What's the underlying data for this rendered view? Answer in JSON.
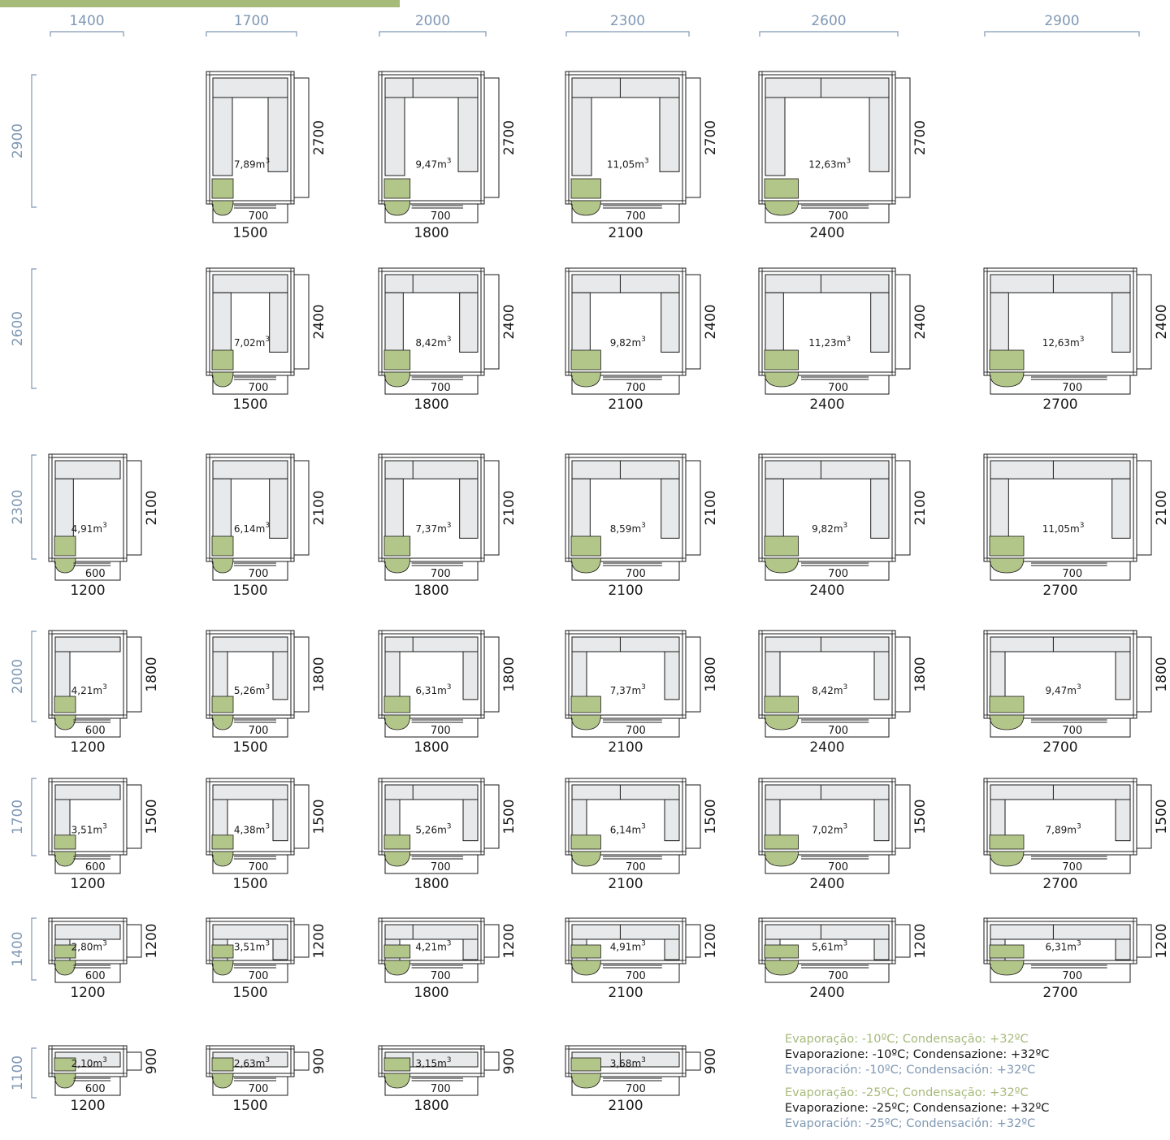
{
  "colors": {
    "line": "#1a1a1a",
    "shelf_fill": "#e8e9eb",
    "evaporator_fill": "#b3c689",
    "accent_green": "#a6ba7a",
    "axis_blue": "#7f98b4",
    "text": "#1a1a1a"
  },
  "columns": [
    {
      "label": "1400"
    },
    {
      "label": "1700"
    },
    {
      "label": "2000"
    },
    {
      "label": "2300"
    },
    {
      "label": "2600"
    },
    {
      "label": "2900"
    }
  ],
  "rows": [
    {
      "label": "2900",
      "inner_depth": "2700"
    },
    {
      "label": "2600",
      "inner_depth": "2400"
    },
    {
      "label": "2300",
      "inner_depth": "2100"
    },
    {
      "label": "2000",
      "inner_depth": "1800"
    },
    {
      "label": "1700",
      "inner_depth": "1500"
    },
    {
      "label": "1400",
      "inner_depth": "1200"
    },
    {
      "label": "1100",
      "inner_depth": "900"
    }
  ],
  "inner_widths": [
    "1200",
    "1500",
    "1800",
    "2100",
    "2400",
    "2700"
  ],
  "cells": [
    {
      "row": 0,
      "col": 1,
      "volume": "7,89",
      "door": "700"
    },
    {
      "row": 0,
      "col": 2,
      "volume": "9,47",
      "door": "700"
    },
    {
      "row": 0,
      "col": 3,
      "volume": "11,05",
      "door": "700"
    },
    {
      "row": 0,
      "col": 4,
      "volume": "12,63",
      "door": "700"
    },
    {
      "row": 1,
      "col": 1,
      "volume": "7,02",
      "door": "700"
    },
    {
      "row": 1,
      "col": 2,
      "volume": "8,42",
      "door": "700"
    },
    {
      "row": 1,
      "col": 3,
      "volume": "9,82",
      "door": "700"
    },
    {
      "row": 1,
      "col": 4,
      "volume": "11,23",
      "door": "700"
    },
    {
      "row": 1,
      "col": 5,
      "volume": "12,63",
      "door": "700"
    },
    {
      "row": 2,
      "col": 0,
      "volume": "4,91",
      "door": "600"
    },
    {
      "row": 2,
      "col": 1,
      "volume": "6,14",
      "door": "700"
    },
    {
      "row": 2,
      "col": 2,
      "volume": "7,37",
      "door": "700"
    },
    {
      "row": 2,
      "col": 3,
      "volume": "8,59",
      "door": "700"
    },
    {
      "row": 2,
      "col": 4,
      "volume": "9,82",
      "door": "700"
    },
    {
      "row": 2,
      "col": 5,
      "volume": "11,05",
      "door": "700"
    },
    {
      "row": 3,
      "col": 0,
      "volume": "4,21",
      "door": "600"
    },
    {
      "row": 3,
      "col": 1,
      "volume": "5,26",
      "door": "700"
    },
    {
      "row": 3,
      "col": 2,
      "volume": "6,31",
      "door": "700"
    },
    {
      "row": 3,
      "col": 3,
      "volume": "7,37",
      "door": "700"
    },
    {
      "row": 3,
      "col": 4,
      "volume": "8,42",
      "door": "700"
    },
    {
      "row": 3,
      "col": 5,
      "volume": "9,47",
      "door": "700"
    },
    {
      "row": 4,
      "col": 0,
      "volume": "3,51",
      "door": "600"
    },
    {
      "row": 4,
      "col": 1,
      "volume": "4,38",
      "door": "700"
    },
    {
      "row": 4,
      "col": 2,
      "volume": "5,26",
      "door": "700"
    },
    {
      "row": 4,
      "col": 3,
      "volume": "6,14",
      "door": "700"
    },
    {
      "row": 4,
      "col": 4,
      "volume": "7,02",
      "door": "700"
    },
    {
      "row": 4,
      "col": 5,
      "volume": "7,89",
      "door": "700"
    },
    {
      "row": 5,
      "col": 0,
      "volume": "2,80",
      "door": "600"
    },
    {
      "row": 5,
      "col": 1,
      "volume": "3,51",
      "door": "700"
    },
    {
      "row": 5,
      "col": 2,
      "volume": "4,21",
      "door": "700"
    },
    {
      "row": 5,
      "col": 3,
      "volume": "4,91",
      "door": "700"
    },
    {
      "row": 5,
      "col": 4,
      "volume": "5,61",
      "door": "700"
    },
    {
      "row": 5,
      "col": 5,
      "volume": "6,31",
      "door": "700"
    },
    {
      "row": 6,
      "col": 0,
      "volume": "2,10",
      "door": "600"
    },
    {
      "row": 6,
      "col": 1,
      "volume": "2,63",
      "door": "700"
    },
    {
      "row": 6,
      "col": 2,
      "volume": "3,15",
      "door": "700"
    },
    {
      "row": 6,
      "col": 3,
      "volume": "3,68",
      "door": "700"
    }
  ],
  "volume_unit": "m",
  "volume_exp": "3",
  "legend": {
    "lines_10": [
      {
        "lang": "pt",
        "text": "Evaporação: -10ºC; Condensação: +32ºC"
      },
      {
        "lang": "it",
        "text": "Evaporazione: -10ºC; Condensazione: +32ºC"
      },
      {
        "lang": "es",
        "text": "Evaporación: -10ºC; Condensación: +32ºC"
      }
    ],
    "lines_25": [
      {
        "lang": "pt",
        "text": "Evaporação: -25ºC; Condensação: +32ºC"
      },
      {
        "lang": "it",
        "text": "Evaporazione: -25ºC; Condensazione: +32ºC"
      },
      {
        "lang": "es",
        "text": "Evaporación: -25ºC; Condensación: +32ºC"
      }
    ]
  }
}
